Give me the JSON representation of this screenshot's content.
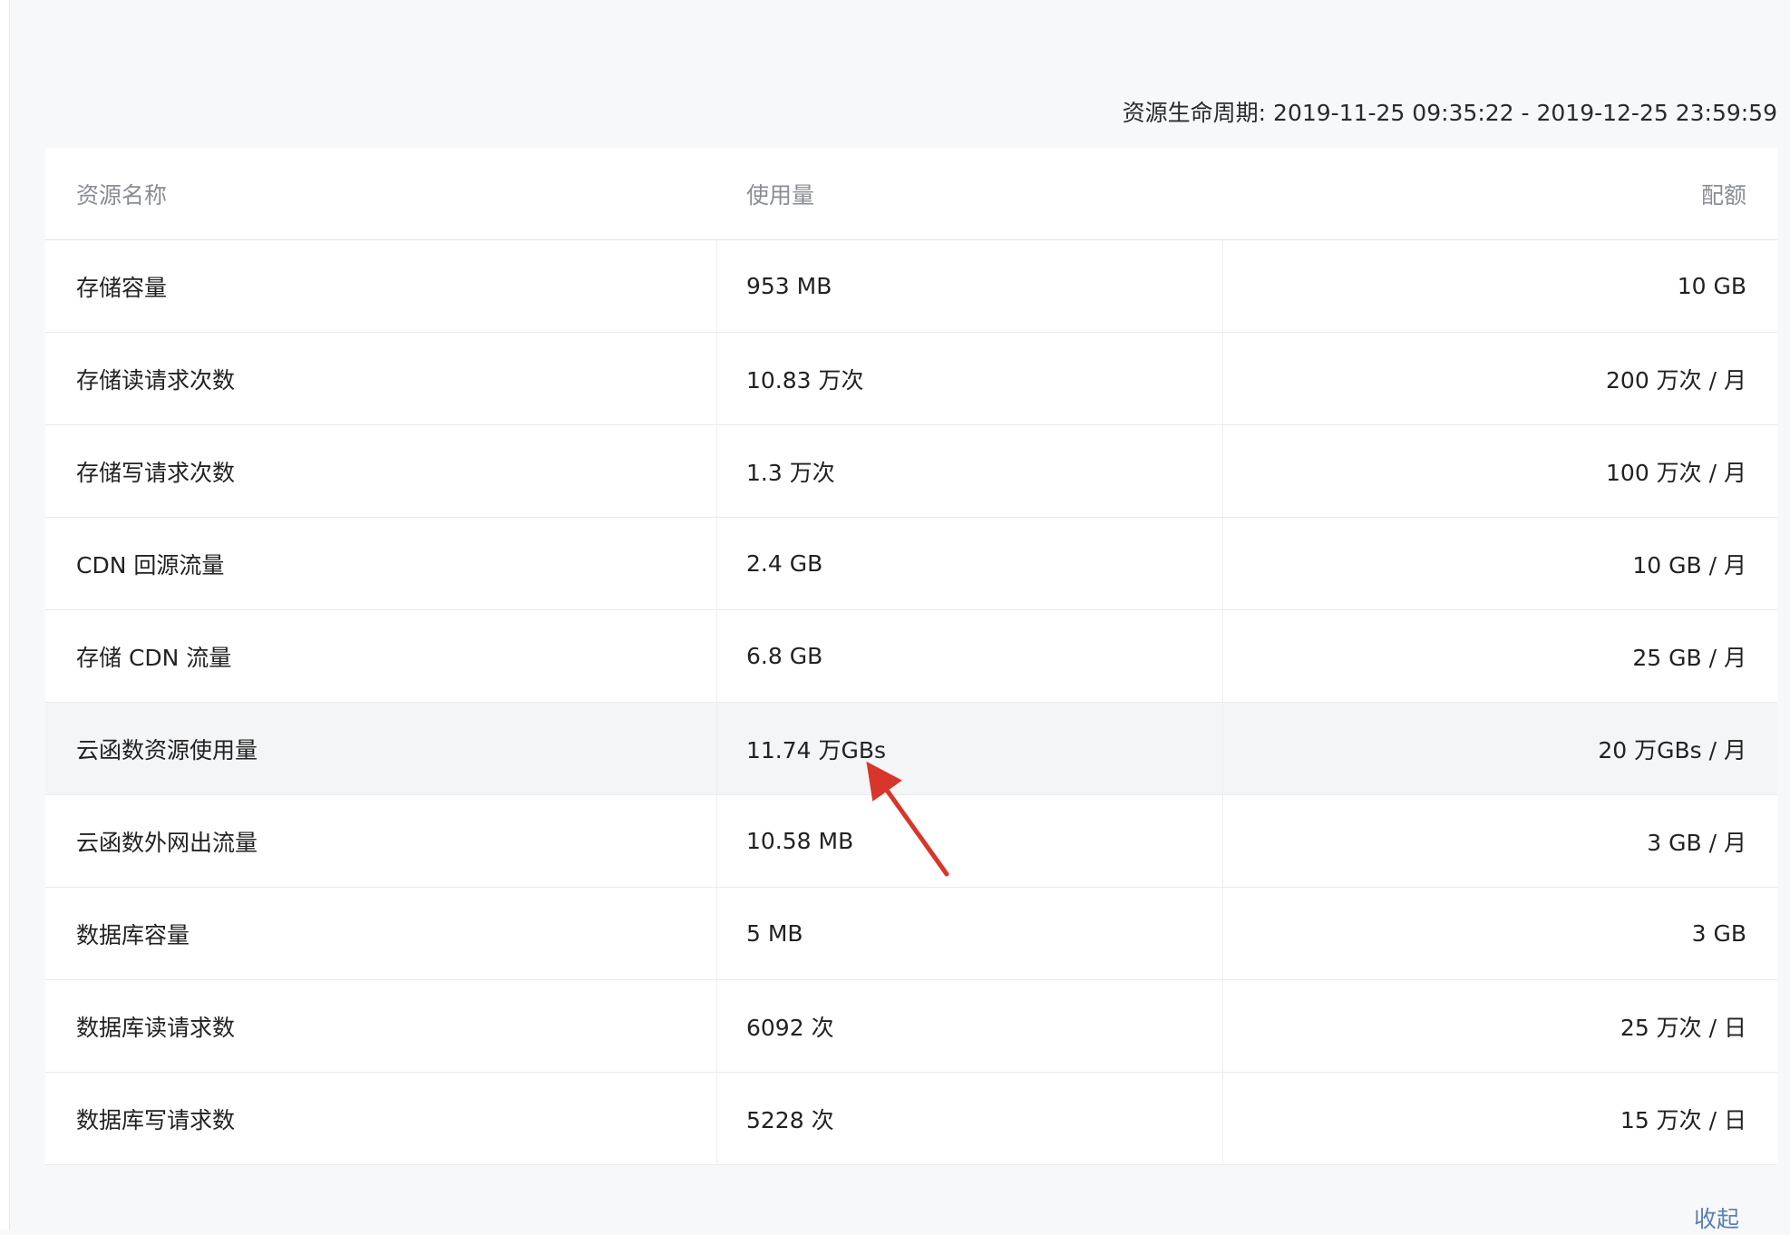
{
  "lifecycle": {
    "label": "资源生命周期:",
    "range": "2019-11-25 09:35:22 - 2019-12-25 23:59:59"
  },
  "table": {
    "headers": [
      "资源名称",
      "使用量",
      "配额"
    ],
    "rows": [
      {
        "name": "存储容量",
        "usage": "953 MB",
        "quota": "10 GB"
      },
      {
        "name": "存储读请求次数",
        "usage": "10.83 万次",
        "quota": "200 万次 / 月"
      },
      {
        "name": "存储写请求次数",
        "usage": "1.3 万次",
        "quota": "100 万次 / 月"
      },
      {
        "name": "CDN 回源流量",
        "usage": "2.4 GB",
        "quota": "10 GB / 月"
      },
      {
        "name": "存储 CDN 流量",
        "usage": "6.8 GB",
        "quota": "25 GB / 月"
      },
      {
        "name": "云函数资源使用量",
        "usage": "11.74 万GBs",
        "quota": "20 万GBs / 月"
      },
      {
        "name": "云函数外网出流量",
        "usage": "10.58 MB",
        "quota": "3 GB / 月"
      },
      {
        "name": "数据库容量",
        "usage": "5 MB",
        "quota": "3 GB"
      },
      {
        "name": "数据库读请求数",
        "usage": "6092 次",
        "quota": "25 万次 / 日"
      },
      {
        "name": "数据库写请求数",
        "usage": "5228 次",
        "quota": "15 万次 / 日"
      }
    ]
  },
  "collapse_label": "收起",
  "colors": {
    "annotation_arrow": "#d9362b",
    "link": "#5b7fb0",
    "highlight_row": "#f4f5f7"
  }
}
